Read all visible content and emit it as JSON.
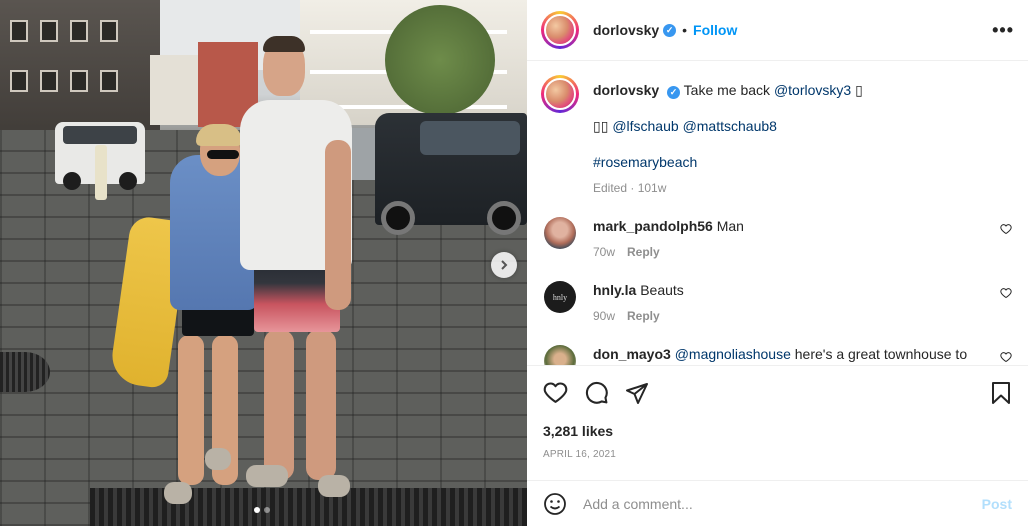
{
  "post": {
    "username": "dorlovsky",
    "verified_mark": "✓",
    "separator": "•",
    "follow_label": "Follow",
    "more_label": "•••",
    "caption": {
      "text": "Take me back",
      "mention": "@torlovsky3",
      "emoji_1": "▯",
      "emoji_line": "▯▯",
      "mention_2": "@lfschaub",
      "mention_3": "@mattschaub8",
      "hashtag": "#rosemarybeach",
      "meta": "Edited · 101w"
    },
    "comments": [
      {
        "username": "mark_pandolph56",
        "text": "Man",
        "age": "70w",
        "reply": "Reply"
      },
      {
        "username": "hnly.la",
        "text": "Beauts",
        "age": "90w",
        "reply": "Reply",
        "avatar_text": "hnly"
      },
      {
        "username": "don_mayo3",
        "mention": "@magnoliashouse",
        "text": "here's a great townhouse to"
      }
    ],
    "likes": "3,281 likes",
    "date": "APRIL 16, 2021",
    "add_comment_placeholder": "Add a comment...",
    "post_label": "Post"
  },
  "carousel": {
    "slides": 2,
    "current": 1
  },
  "colors": {
    "follow": "#0095f6",
    "link": "#00376b",
    "muted": "#8e8e8e",
    "post_disabled": "#b2dffc"
  }
}
